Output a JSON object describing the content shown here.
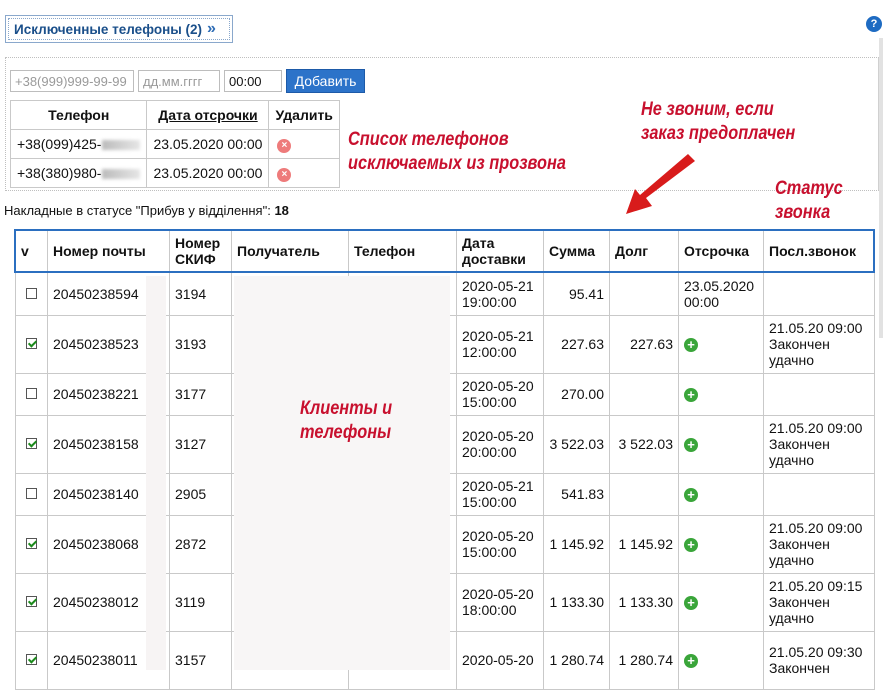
{
  "header": {
    "excluded_label": "Исключенные телефоны (2)",
    "chevron": "»",
    "help": "?"
  },
  "excluded": {
    "phone_placeholder": "+38(999)999-99-99",
    "date_placeholder": "дд.мм.гггг",
    "time_value": "00:00",
    "add_label": "Добавить",
    "columns": [
      "Телефон",
      "Дата отсрочки",
      "Удалить"
    ],
    "rows": [
      {
        "phone": "+38(099)425-",
        "date": "23.05.2020 00:00",
        "delete": "×"
      },
      {
        "phone": "+38(380)980-",
        "date": "23.05.2020 00:00",
        "delete": "×"
      }
    ]
  },
  "annotations": {
    "list_line1": "Список телефонов",
    "list_line2": "исключаемых из прозвона",
    "prepaid_line1": "Не звоним, если",
    "prepaid_line2": "заказ предоплачен",
    "status_line1": "Статус",
    "status_line2": "звонка",
    "clients_line1": "Клиенты и",
    "clients_line2": "телефоны"
  },
  "summary": {
    "text": "Накладные в статусе \"Прибув у відділення\": ",
    "count": "18"
  },
  "table": {
    "columns": {
      "v": "v",
      "waybill": "Номер почты",
      "skif1": "Номер",
      "skif2": "СКИФ",
      "recipient": "Получатель",
      "phone": "Телефон",
      "date1": "Дата",
      "date2": "доставки",
      "sum": "Сумма",
      "debt": "Долг",
      "defer": "Отсрочка",
      "last": "Посл.звонок"
    },
    "rows": [
      {
        "checked": false,
        "waybill": "20450238594",
        "skif": "3194",
        "date1": "2020-05-21",
        "date2": "19:00:00",
        "sum": "95.41",
        "debt": "",
        "defer1": "23.05.2020",
        "defer2": "00:00",
        "plus": false,
        "last1": "",
        "last2": "",
        "last3": ""
      },
      {
        "checked": true,
        "waybill": "20450238523",
        "skif": "3193",
        "date1": "2020-05-21",
        "date2": "12:00:00",
        "sum": "227.63",
        "debt": "227.63",
        "defer1": "",
        "defer2": "",
        "plus": true,
        "last1": "21.05.20 09:00",
        "last2": "Закончен",
        "last3": "удачно"
      },
      {
        "checked": false,
        "waybill": "20450238221",
        "skif": "3177",
        "date1": "2020-05-20",
        "date2": "15:00:00",
        "sum": "270.00",
        "debt": "",
        "defer1": "",
        "defer2": "",
        "plus": true,
        "last1": "",
        "last2": "",
        "last3": ""
      },
      {
        "checked": true,
        "waybill": "20450238158",
        "skif": "3127",
        "date1": "2020-05-20",
        "date2": "20:00:00",
        "sum": "3 522.03",
        "debt": "3 522.03",
        "defer1": "",
        "defer2": "",
        "plus": true,
        "last1": "21.05.20 09:00",
        "last2": "Закончен",
        "last3": "удачно"
      },
      {
        "checked": false,
        "waybill": "20450238140",
        "skif": "2905",
        "date1": "2020-05-21",
        "date2": "15:00:00",
        "sum": "541.83",
        "debt": "",
        "defer1": "",
        "defer2": "",
        "plus": true,
        "last1": "",
        "last2": "",
        "last3": ""
      },
      {
        "checked": true,
        "waybill": "20450238068",
        "skif": "2872",
        "date1": "2020-05-20",
        "date2": "15:00:00",
        "sum": "1 145.92",
        "debt": "1 145.92",
        "defer1": "",
        "defer2": "",
        "plus": true,
        "last1": "21.05.20 09:00",
        "last2": "Закончен",
        "last3": "удачно"
      },
      {
        "checked": true,
        "waybill": "20450238012",
        "skif": "3119",
        "date1": "2020-05-20",
        "date2": "18:00:00",
        "sum": "1 133.30",
        "debt": "1 133.30",
        "defer1": "",
        "defer2": "",
        "plus": true,
        "last1": "21.05.20 09:15",
        "last2": "Закончен",
        "last3": "удачно"
      },
      {
        "checked": true,
        "waybill": "20450238011",
        "skif": "3157",
        "date1": "2020-05-20",
        "date2": "",
        "sum": "1 280.74",
        "debt": "1 280.74",
        "defer1": "",
        "defer2": "",
        "plus": true,
        "last1": "21.05.20 09:30",
        "last2": "Закончен",
        "last3": ""
      }
    ]
  },
  "colors": {
    "accent": "#2b6fc0",
    "annotation": "#c8102e",
    "ok": "#3aa53a",
    "delete": "#ee7b7b"
  }
}
